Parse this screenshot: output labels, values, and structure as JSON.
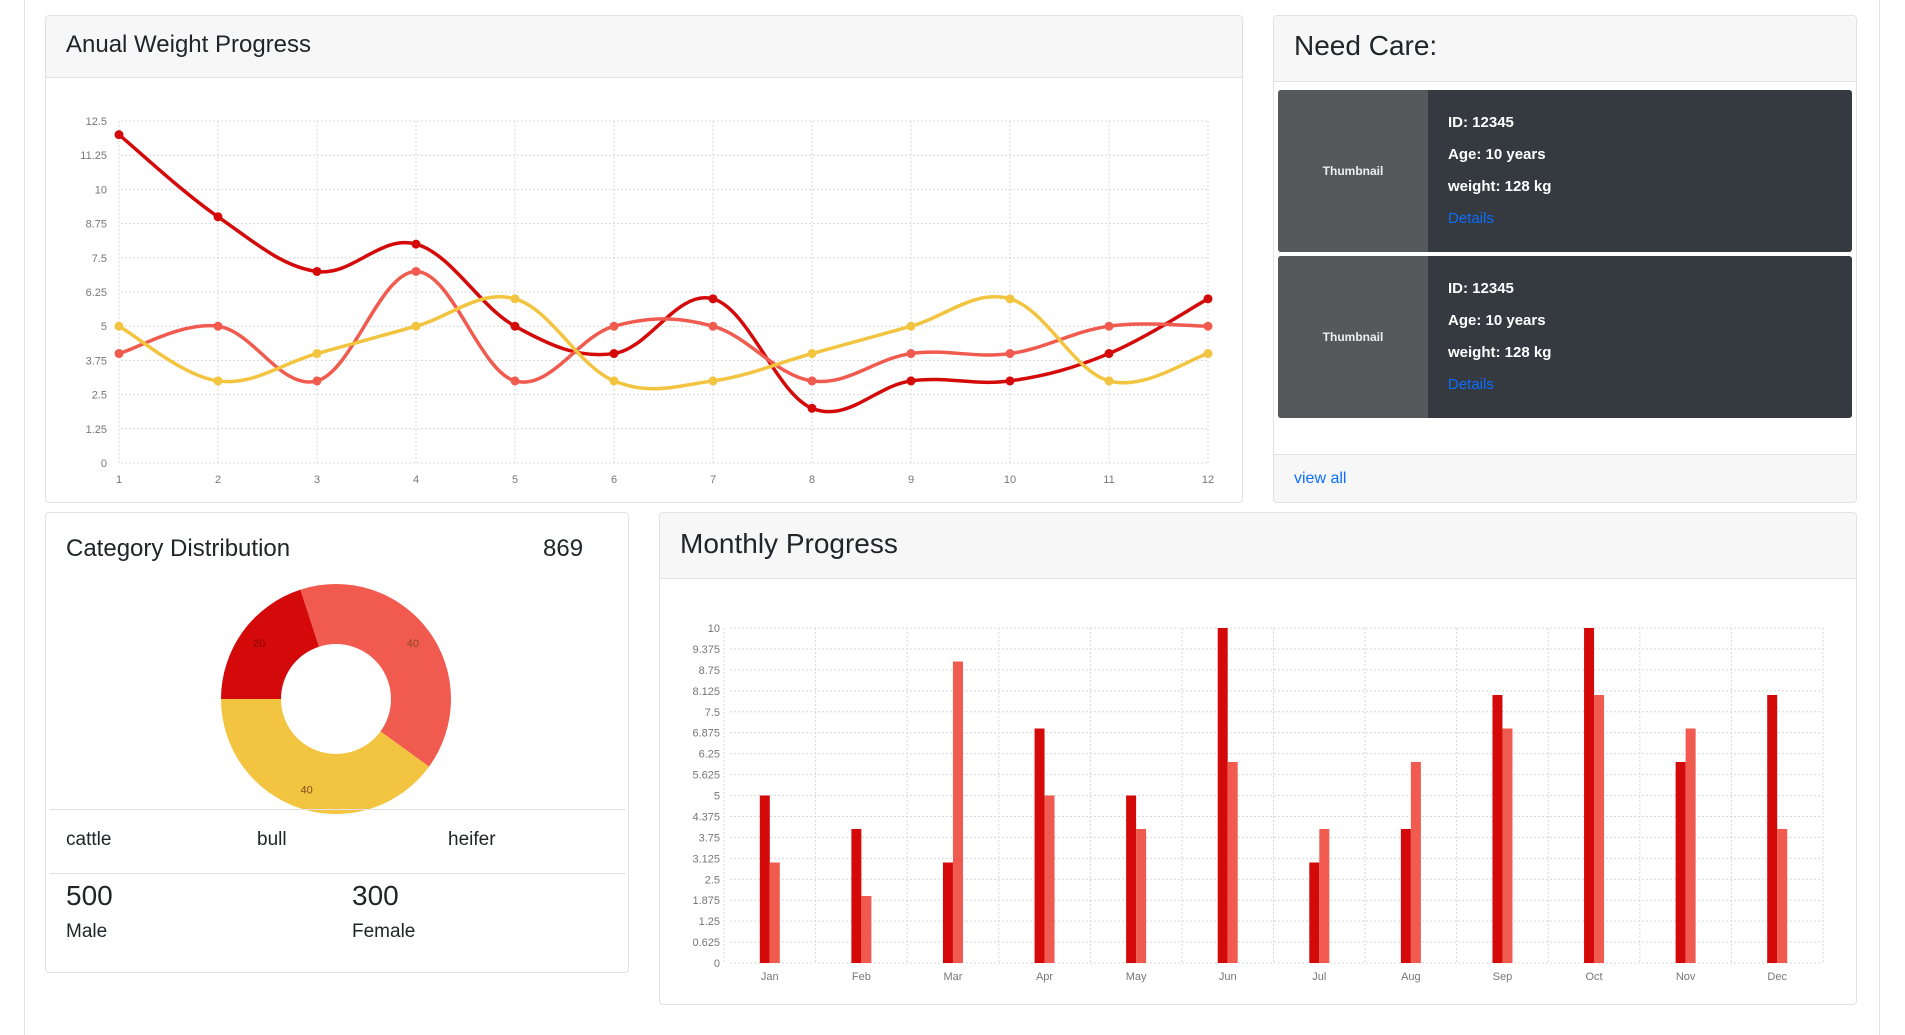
{
  "annual": {
    "title": "Anual Weight Progress",
    "chart_data": {
      "type": "line",
      "x": [
        1,
        2,
        3,
        4,
        5,
        6,
        7,
        8,
        9,
        10,
        11,
        12
      ],
      "ylim": [
        0,
        12.5
      ],
      "y_ticks": [
        "0",
        "1.25",
        "2.5",
        "3.75",
        "5",
        "6.25",
        "7.5",
        "8.75",
        "10",
        "11.25",
        "12.5"
      ],
      "grid": true,
      "series": [
        {
          "color": "#d40a0a",
          "values": [
            12,
            9,
            7,
            8,
            5,
            4,
            6,
            2,
            3,
            3,
            4,
            6
          ]
        },
        {
          "color": "#f05a4f",
          "values": [
            4,
            5,
            3,
            7,
            3,
            5,
            5,
            3,
            4,
            4,
            5,
            5
          ]
        },
        {
          "color": "#f3c43f",
          "values": [
            5,
            3,
            4,
            5,
            6,
            3,
            3,
            4,
            5,
            6,
            3,
            4
          ]
        }
      ]
    }
  },
  "care": {
    "title": "Need Care:",
    "items": [
      {
        "thumb": "Thumbnail",
        "id": "ID: 12345",
        "age": "Age: 10 years",
        "weight": "weight: 128 kg",
        "link": "Details"
      },
      {
        "thumb": "Thumbnail",
        "id": "ID: 12345",
        "age": "Age: 10 years",
        "weight": "weight: 128 kg",
        "link": "Details"
      }
    ],
    "view_all": "view all"
  },
  "category": {
    "title": "Category Distribution",
    "total": "869",
    "chart_data": {
      "type": "pie",
      "slices": [
        {
          "value": 20,
          "label": "20",
          "color": "#d40a0a"
        },
        {
          "value": 40,
          "label": "40",
          "color": "#f05a4f"
        },
        {
          "value": 40,
          "label": "40",
          "color": "#f3c43f"
        }
      ]
    },
    "legend": [
      "cattle",
      "bull",
      "heifer"
    ],
    "stats": [
      {
        "value": "500",
        "label": "Male"
      },
      {
        "value": "300",
        "label": "Female"
      }
    ]
  },
  "monthly": {
    "title": "Monthly Progress",
    "chart_data": {
      "type": "bar",
      "categories": [
        "Jan",
        "Feb",
        "Mar",
        "Apr",
        "May",
        "Jun",
        "Jul",
        "Aug",
        "Sep",
        "Oct",
        "Nov",
        "Dec"
      ],
      "ylim": [
        0,
        10
      ],
      "y_ticks": [
        "0",
        "0.625",
        "1.25",
        "1.875",
        "2.5",
        "3.125",
        "3.75",
        "4.375",
        "5",
        "5.625",
        "6.25",
        "6.875",
        "7.5",
        "8.125",
        "8.75",
        "9.375",
        "10"
      ],
      "grid": true,
      "series": [
        {
          "color": "#d40a0a",
          "values": [
            5,
            4,
            3,
            7,
            5,
            10,
            3,
            4,
            8,
            10,
            6,
            8
          ]
        },
        {
          "color": "#f05a4f",
          "values": [
            3,
            2,
            9,
            5,
            4,
            6,
            4,
            6,
            7,
            8,
            7,
            4
          ]
        }
      ]
    }
  }
}
